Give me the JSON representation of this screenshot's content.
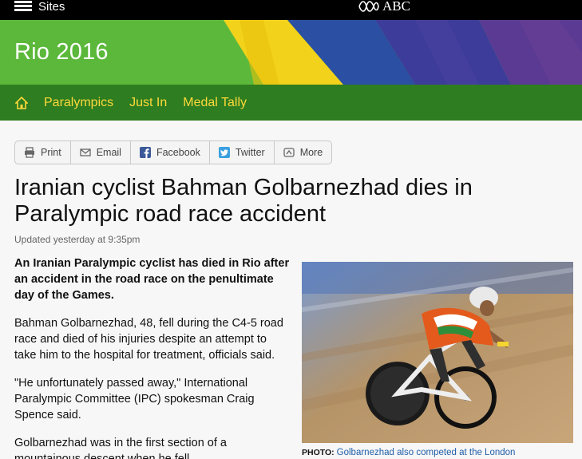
{
  "topbar": {
    "sites_label": "Sites",
    "logo_text": "ABC"
  },
  "banner": {
    "title": "Rio 2016"
  },
  "nav": {
    "items": [
      "Paralympics",
      "Just In",
      "Medal Tally"
    ]
  },
  "share": {
    "print": "Print",
    "email": "Email",
    "facebook": "Facebook",
    "twitter": "Twitter",
    "more": "More"
  },
  "article": {
    "headline": "Iranian cyclist Bahman Golbarnezhad dies in Paralympic road race accident",
    "updated": "Updated yesterday at 9:35pm",
    "paragraphs": [
      "An Iranian Paralympic cyclist has died in Rio after an accident in the road race on the penultimate day of the Games.",
      "Bahman Golbarnezhad, 48, fell during the C4-5 road race and died of his injuries despite an attempt to take him to the hospital for treatment, officials said.",
      "\"He unfortunately passed away,\" International Paralympic Committee (IPC) spokesman Craig Spence said.",
      "Golbarnezhad was in the first section of a mountainous descent when he fell."
    ]
  },
  "photo": {
    "caption_label": "PHOTO:",
    "caption_text": "Golbarnezhad also competed at the London"
  },
  "colors": {
    "nav_bg": "#2e7d20",
    "nav_link": "#ffd93a",
    "banner_green": "#5bb83a",
    "link_blue": "#1f5ea8"
  }
}
